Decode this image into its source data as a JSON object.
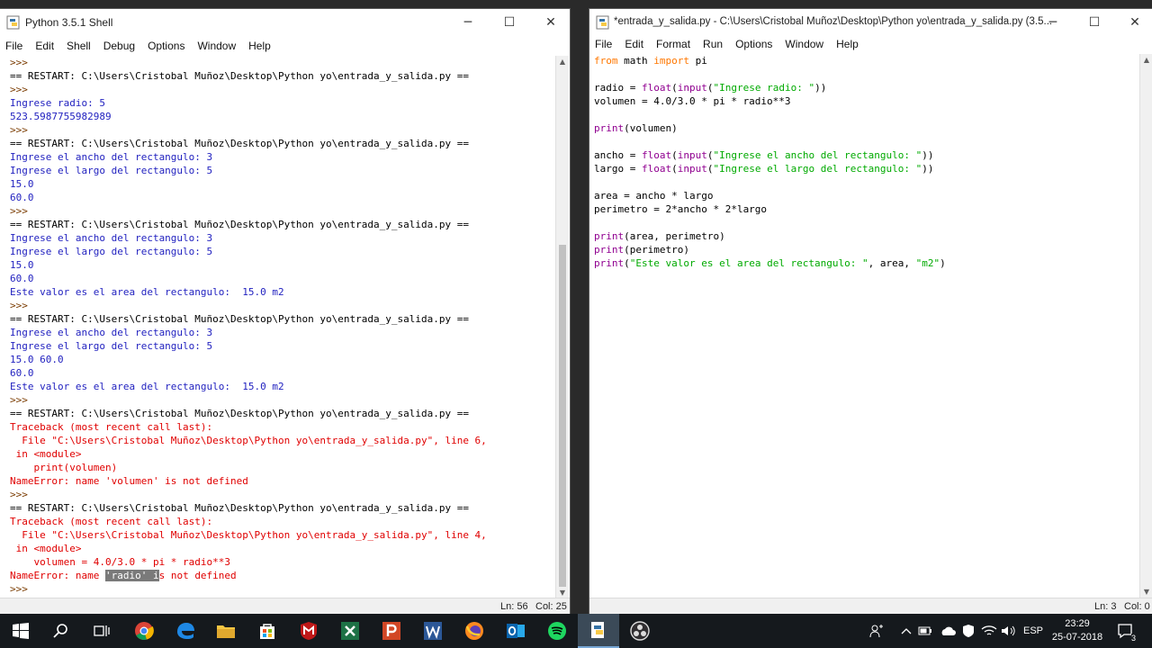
{
  "shell": {
    "title": "Python 3.5.1 Shell",
    "menu": [
      "File",
      "Edit",
      "Shell",
      "Debug",
      "Options",
      "Window",
      "Help"
    ],
    "lines": [
      {
        "t": ">>> ",
        "c": "prompt"
      },
      {
        "t": "== RESTART: C:\\Users\\Cristobal Muñoz\\Desktop\\Python yo\\entrada_y_salida.py ==",
        "c": "normal"
      },
      {
        "t": ">>> ",
        "c": "prompt"
      },
      {
        "t": "Ingrese radio: 5",
        "c": "out"
      },
      {
        "t": "523.5987755982989",
        "c": "out"
      },
      {
        "t": ">>> ",
        "c": "prompt"
      },
      {
        "t": "== RESTART: C:\\Users\\Cristobal Muñoz\\Desktop\\Python yo\\entrada_y_salida.py ==",
        "c": "normal"
      },
      {
        "t": "Ingrese el ancho del rectangulo: 3",
        "c": "out"
      },
      {
        "t": "Ingrese el largo del rectangulo: 5",
        "c": "out"
      },
      {
        "t": "15.0",
        "c": "out"
      },
      {
        "t": "60.0",
        "c": "out"
      },
      {
        "t": ">>> ",
        "c": "prompt"
      },
      {
        "t": "== RESTART: C:\\Users\\Cristobal Muñoz\\Desktop\\Python yo\\entrada_y_salida.py ==",
        "c": "normal"
      },
      {
        "t": "Ingrese el ancho del rectangulo: 3",
        "c": "out"
      },
      {
        "t": "Ingrese el largo del rectangulo: 5",
        "c": "out"
      },
      {
        "t": "15.0",
        "c": "out"
      },
      {
        "t": "60.0",
        "c": "out"
      },
      {
        "t": "Este valor es el area del rectangulo:  15.0 m2",
        "c": "out"
      },
      {
        "t": ">>> ",
        "c": "prompt"
      },
      {
        "t": "== RESTART: C:\\Users\\Cristobal Muñoz\\Desktop\\Python yo\\entrada_y_salida.py ==",
        "c": "normal"
      },
      {
        "t": "Ingrese el ancho del rectangulo: 3",
        "c": "out"
      },
      {
        "t": "Ingrese el largo del rectangulo: 5",
        "c": "out"
      },
      {
        "t": "15.0 60.0",
        "c": "out"
      },
      {
        "t": "60.0",
        "c": "out"
      },
      {
        "t": "Este valor es el area del rectangulo:  15.0 m2",
        "c": "out"
      },
      {
        "t": ">>> ",
        "c": "prompt"
      },
      {
        "t": "== RESTART: C:\\Users\\Cristobal Muñoz\\Desktop\\Python yo\\entrada_y_salida.py ==",
        "c": "normal"
      },
      {
        "t": "Traceback (most recent call last):",
        "c": "err"
      },
      {
        "t": "  File \"C:\\Users\\Cristobal Muñoz\\Desktop\\Python yo\\entrada_y_salida.py\", line 6,",
        "c": "err"
      },
      {
        "t": " in <module>",
        "c": "err"
      },
      {
        "t": "    print(volumen)",
        "c": "err"
      },
      {
        "t": "NameError: name 'volumen' is not defined",
        "c": "err"
      },
      {
        "t": ">>> ",
        "c": "prompt"
      },
      {
        "t": "== RESTART: C:\\Users\\Cristobal Muñoz\\Desktop\\Python yo\\entrada_y_salida.py ==",
        "c": "normal"
      },
      {
        "t": "Traceback (most recent call last):",
        "c": "err"
      },
      {
        "t": "  File \"C:\\Users\\Cristobal Muñoz\\Desktop\\Python yo\\entrada_y_salida.py\", line 4,",
        "c": "err"
      },
      {
        "t": " in <module>",
        "c": "err"
      },
      {
        "t": "    volumen = 4.0/3.0 * pi * radio**3",
        "c": "err"
      },
      {
        "t": "NameError: name ",
        "c": "err",
        "sel": "'radio' i",
        "rest": "s not defined"
      },
      {
        "t": ">>> ",
        "c": "prompt"
      }
    ],
    "status_ln": "Ln: 56",
    "status_col": "Col: 25"
  },
  "editor": {
    "title": "*entrada_y_salida.py - C:\\Users\\Cristobal Muñoz\\Desktop\\Python yo\\entrada_y_salida.py (3.5...",
    "menu": [
      "File",
      "Edit",
      "Format",
      "Run",
      "Options",
      "Window",
      "Help"
    ],
    "lines": [
      [
        [
          "from",
          "kw"
        ],
        [
          " math ",
          "normal"
        ],
        [
          "import",
          "kw"
        ],
        [
          " pi",
          "normal"
        ]
      ],
      [],
      [
        [
          "radio = ",
          "normal"
        ],
        [
          "float",
          "bi"
        ],
        [
          "(",
          "normal"
        ],
        [
          "input",
          "bi"
        ],
        [
          "(",
          "normal"
        ],
        [
          "\"Ingrese radio: \"",
          "str"
        ],
        [
          "))",
          "normal"
        ]
      ],
      [
        [
          "volumen = 4.0/3.0 * pi * radio**3",
          "normal"
        ]
      ],
      [],
      [
        [
          "print",
          "bi"
        ],
        [
          "(volumen)",
          "normal"
        ]
      ],
      [],
      [
        [
          "ancho = ",
          "normal"
        ],
        [
          "float",
          "bi"
        ],
        [
          "(",
          "normal"
        ],
        [
          "input",
          "bi"
        ],
        [
          "(",
          "normal"
        ],
        [
          "\"Ingrese el ancho del rectangulo: \"",
          "str"
        ],
        [
          "))",
          "normal"
        ]
      ],
      [
        [
          "largo = ",
          "normal"
        ],
        [
          "float",
          "bi"
        ],
        [
          "(",
          "normal"
        ],
        [
          "input",
          "bi"
        ],
        [
          "(",
          "normal"
        ],
        [
          "\"Ingrese el largo del rectangulo: \"",
          "str"
        ],
        [
          "))",
          "normal"
        ]
      ],
      [],
      [
        [
          "area = ancho * largo",
          "normal"
        ]
      ],
      [
        [
          "perimetro = 2*ancho * 2*largo",
          "normal"
        ]
      ],
      [],
      [
        [
          "print",
          "bi"
        ],
        [
          "(area, perimetro)",
          "normal"
        ]
      ],
      [
        [
          "print",
          "bi"
        ],
        [
          "(perimetro)",
          "normal"
        ]
      ],
      [
        [
          "print",
          "bi"
        ],
        [
          "(",
          "normal"
        ],
        [
          "\"Este valor es el area del rectangulo: \"",
          "str"
        ],
        [
          ", area, ",
          "normal"
        ],
        [
          "\"m2\"",
          "str"
        ],
        [
          ")",
          "normal"
        ]
      ]
    ],
    "status_ln": "Ln: 3",
    "status_col": "Col: 0"
  },
  "window_controls": {
    "minimize": "─",
    "maximize": "☐",
    "close": "✕"
  },
  "taskbar": {
    "language": "ESP",
    "time": "23:29",
    "date": "25-07-2018",
    "notifications": "3",
    "apps": [
      "start-icon",
      "search-icon",
      "task-view-icon",
      "chrome-icon",
      "edge-icon",
      "file-explorer-icon",
      "store-icon",
      "mcafee-icon",
      "excel-icon",
      "powerpoint-icon",
      "word-icon",
      "firefox-icon",
      "outlook-icon",
      "spotify-icon",
      "python-idle-icon",
      "obs-icon"
    ],
    "colors": {
      "chrome": "#e8b21e",
      "edge": "#1e88e5",
      "explorer": "#f4c542",
      "excel": "#1d7145",
      "powerpoint": "#d24726",
      "word": "#2b5797",
      "firefox": "#ff8a1f",
      "outlook": "#0a64ad",
      "spotify": "#1ed760",
      "mcafee": "#c01818"
    }
  }
}
